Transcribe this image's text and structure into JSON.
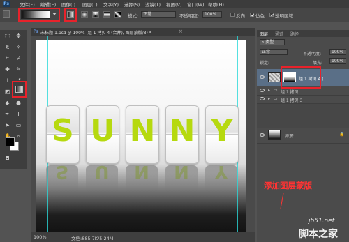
{
  "app": {
    "logo": "Ps"
  },
  "menu": [
    "文件(F)",
    "编辑(E)",
    "图像(I)",
    "图层(L)",
    "文字(Y)",
    "选择(S)",
    "滤镜(T)",
    "视图(V)",
    "窗口(W)",
    "帮助(H)"
  ],
  "options": {
    "mode_label": "模式:",
    "mode_value": "正常",
    "opacity_label": "不透明度:",
    "opacity_value": "100%",
    "reverse_label": "反向",
    "dither_label": "仿色",
    "transparency_label": "透明区域"
  },
  "document": {
    "tab_title": "未标题-1.psd @ 100% (组 1 拷贝 4 (合并), 图层蒙版/8) *",
    "letters": [
      "S",
      "U",
      "N",
      "N",
      "Y"
    ],
    "zoom": "100%",
    "doc_info": "文档:885.7K/5.24M"
  },
  "layers_panel": {
    "tabs": [
      "图层",
      "通道",
      "路径"
    ],
    "kind_label": "类型",
    "blend_mode": "正常",
    "opacity_label": "不透明度:",
    "opacity_value": "100%",
    "lock_label": "锁定:",
    "fill_label": "填充:",
    "fill_value": "100%",
    "layers": [
      {
        "name": "组 1 拷贝 4 (..."
      },
      {
        "name": "组 1 拷贝"
      },
      {
        "name": "组 1 拷贝 3"
      },
      {
        "name": "背景"
      }
    ]
  },
  "annotation": "添加图层蒙版",
  "watermark": {
    "site": "jb51.net",
    "brand": "脚本之家"
  },
  "colors": {
    "highlight": "#e8222b",
    "letter": "#b6d90f",
    "guide": "#2ad8d8"
  }
}
